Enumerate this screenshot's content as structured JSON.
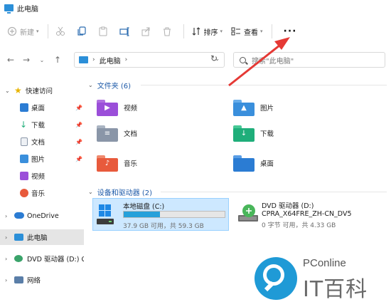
{
  "window": {
    "title": "此电脑"
  },
  "toolbar": {
    "new_label": "新建",
    "sort_label": "排序",
    "view_label": "查看",
    "more_label": "···"
  },
  "address": {
    "crumb": "此电脑"
  },
  "search": {
    "placeholder": "搜索\"此电脑\""
  },
  "sidebar": {
    "quick_access": "快速访问",
    "items": [
      {
        "label": "桌面",
        "pinned": true,
        "icon": "desktop-icon",
        "color": "#2b7cd3"
      },
      {
        "label": "下载",
        "pinned": true,
        "icon": "download-icon",
        "color": "#1fae7a"
      },
      {
        "label": "文档",
        "pinned": true,
        "icon": "document-icon",
        "color": "#8a96a8"
      },
      {
        "label": "图片",
        "pinned": true,
        "icon": "pictures-icon",
        "color": "#3a8fdc"
      },
      {
        "label": "视频",
        "pinned": false,
        "icon": "videos-icon",
        "color": "#9b4fd9"
      },
      {
        "label": "音乐",
        "pinned": false,
        "icon": "music-icon",
        "color": "#e85a3c"
      }
    ],
    "onedrive": "OneDrive",
    "this_pc": "此电脑",
    "dvd": "DVD 驱动器 (D:) CI",
    "network": "网络"
  },
  "content": {
    "folders_header": "文件夹 (6)",
    "folders": [
      {
        "label": "视频",
        "icon": "videos-folder-icon",
        "color": "#9b4fd9"
      },
      {
        "label": "图片",
        "icon": "pictures-folder-icon",
        "color": "#3a8fdc"
      },
      {
        "label": "文档",
        "icon": "documents-folder-icon",
        "color": "#8a96a8"
      },
      {
        "label": "下载",
        "icon": "downloads-folder-icon",
        "color": "#1fae7a"
      },
      {
        "label": "音乐",
        "icon": "music-folder-icon",
        "color": "#e85a3c"
      },
      {
        "label": "桌面",
        "icon": "desktop-folder-icon",
        "color": "#2b7cd3"
      }
    ],
    "drives_header": "设备和驱动器 (2)",
    "drives": [
      {
        "name": "本地磁盘 (C:)",
        "stat": "37.9 GB 可用，共 59.3 GB",
        "used_fraction": 0.36
      },
      {
        "name": "DVD 驱动器 (D:)",
        "name2": "CPRA_X64FRE_ZH-CN_DV5",
        "stat": "0 字节 可用，共 4.33 GB"
      }
    ]
  },
  "watermark": {
    "brand": "PConline",
    "sub": "IT百科"
  }
}
